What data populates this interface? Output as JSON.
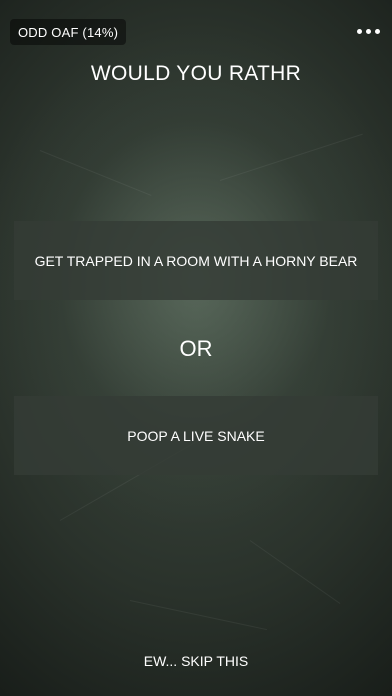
{
  "score_badge": "ODD OAF (14%)",
  "menu": {
    "icon": "more-dots-icon"
  },
  "title": "WOULD YOU RATHR",
  "option_a": "GET TRAPPED IN A ROOM WITH A HORNY BEAR",
  "separator": "OR",
  "option_b": "POOP A LIVE SNAKE",
  "skip_label": "EW... SKIP THIS",
  "colors": {
    "background_center": "#3e4a40",
    "background_edge": "#0a0c0a",
    "option_fill": "#343c36",
    "text": "#ffffff"
  }
}
